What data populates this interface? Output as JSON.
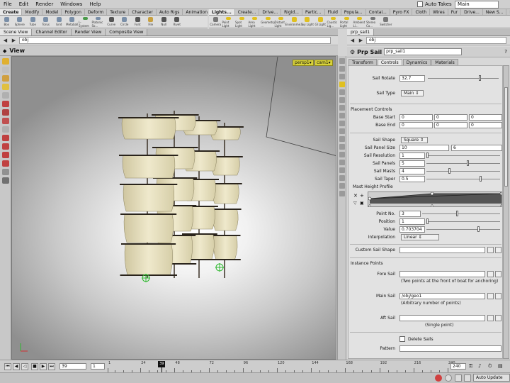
{
  "menubar": {
    "items": [
      "File",
      "Edit",
      "Render",
      "Windows",
      "Help"
    ]
  },
  "auto_takes": {
    "label": "Auto Takes"
  },
  "desktop": {
    "value": "Main"
  },
  "shelf_tabs_left": [
    {
      "label": "Create",
      "active": true
    },
    {
      "label": "Modify",
      "active": false
    },
    {
      "label": "Model",
      "active": false
    },
    {
      "label": "Polygon",
      "active": false
    },
    {
      "label": "Deform",
      "active": false
    },
    {
      "label": "Texture",
      "active": false
    },
    {
      "label": "Character",
      "active": false
    },
    {
      "label": "Auto Rigs",
      "active": false
    },
    {
      "label": "Animation",
      "active": false
    }
  ],
  "shelf_tabs_right": [
    {
      "label": "Lights...",
      "active": true
    },
    {
      "label": "Create...",
      "active": false
    },
    {
      "label": "Drive...",
      "active": false
    },
    {
      "label": "Rigid...",
      "active": false
    },
    {
      "label": "Partic...",
      "active": false
    },
    {
      "label": "Fluid",
      "active": false
    },
    {
      "label": "Popula...",
      "active": false
    },
    {
      "label": "Contai...",
      "active": false
    },
    {
      "label": "Pyro FX",
      "active": false
    },
    {
      "label": "Cloth",
      "active": false
    },
    {
      "label": "Wires",
      "active": false
    },
    {
      "label": "Fur",
      "active": false
    },
    {
      "label": "Drive...",
      "active": false
    },
    {
      "label": "New S...",
      "active": false
    },
    {
      "label": "New S...",
      "active": false
    }
  ],
  "create_tools": [
    {
      "label": "Box",
      "color": "#7a8fa8"
    },
    {
      "label": "Sphere",
      "color": "#7a8fa8"
    },
    {
      "label": "Tube",
      "color": "#7a8fa8"
    },
    {
      "label": "Torus",
      "color": "#7a8fa8"
    },
    {
      "label": "Grid",
      "color": "#7a8fa8"
    },
    {
      "label": "Metaball",
      "color": "#7a8fa8"
    },
    {
      "label": "L-System",
      "color": "#4a9a4a"
    },
    {
      "label": "Platonic So...",
      "color": "#7a8fa8"
    },
    {
      "label": "Curve",
      "color": "#555555"
    },
    {
      "label": "Circle",
      "color": "#7a8fa8"
    },
    {
      "label": "Font",
      "color": "#555555"
    },
    {
      "label": "File",
      "color": "#c8a040"
    },
    {
      "label": "Null",
      "color": "#555555"
    },
    {
      "label": "Rivet",
      "color": "#555555"
    }
  ],
  "light_tools": [
    {
      "label": "Camera",
      "color": "#777777"
    },
    {
      "label": "Point Light",
      "color": "#e0c020"
    },
    {
      "label": "Spot Light",
      "color": "#e0c020"
    },
    {
      "label": "Area Light",
      "color": "#e0c020"
    },
    {
      "label": "Geometry ...",
      "color": "#e0c020"
    },
    {
      "label": "Distant Light",
      "color": "#e0c020"
    },
    {
      "label": "Environme...",
      "color": "#e0c020"
    },
    {
      "label": "Sky Light",
      "color": "#e0c020"
    },
    {
      "label": "GI Light",
      "color": "#e0c020"
    },
    {
      "label": "Caustic Lig...",
      "color": "#e0c020"
    },
    {
      "label": "Portal Light",
      "color": "#e0c020"
    },
    {
      "label": "Ambient Li...",
      "color": "#e0c020"
    },
    {
      "label": "Stereo Ca...",
      "color": "#777777"
    },
    {
      "label": "Switcher",
      "color": "#777777"
    }
  ],
  "pane_tabs": [
    {
      "label": "Scene View",
      "active": true
    },
    {
      "label": "Channel Editor",
      "active": false
    },
    {
      "label": "Render View",
      "active": false
    },
    {
      "label": "Composite View",
      "active": false
    }
  ],
  "scene_path": "obj",
  "view_title": "View",
  "viewport": {
    "persp": "persp1▾",
    "cam": "cam1▾"
  },
  "props_tab": "prp_sail1",
  "props_path": "obj",
  "node": {
    "type": "Prp Sail",
    "name": "prp_sail1"
  },
  "parm_tabs": [
    {
      "label": "Transform",
      "active": false
    },
    {
      "label": "Controls",
      "active": true
    },
    {
      "label": "Dynamics",
      "active": false
    },
    {
      "label": "Materials",
      "active": false
    }
  ],
  "parms": {
    "sail_rotate": {
      "label": "Sail Rotate",
      "value": "32.7",
      "fraction": 0.62
    },
    "sail_type": {
      "label": "Sail Type",
      "value": "Main"
    },
    "placement_controls": "Placement Controls",
    "base_start": {
      "label": "Base Start",
      "values": [
        "0",
        "0",
        "0"
      ]
    },
    "base_end": {
      "label": "Base End",
      "values": [
        "0",
        "0",
        "0"
      ]
    },
    "sail_shape": {
      "label": "Sail Shape",
      "value": "Square"
    },
    "sail_panel_size": {
      "label": "Sail Panel Size",
      "values": [
        "10",
        "6"
      ]
    },
    "sail_resolution": {
      "label": "Sail Resolution",
      "value": "1",
      "fraction": 0.0
    },
    "sail_panels": {
      "label": "Sail Panels",
      "value": "5",
      "fraction": 0.55
    },
    "sail_masts": {
      "label": "Sail Masts",
      "value": "4",
      "fraction": 0.3
    },
    "sail_taper": {
      "label": "Sail Taper",
      "value": "0.5",
      "fraction": 0.72
    },
    "mast_height_profile": "Mast Height Profile",
    "point_no": {
      "label": "Point No.",
      "value": "3",
      "fraction": 0.45
    },
    "position": {
      "label": "Position",
      "value": "1",
      "fraction": 0.0
    },
    "value": {
      "label": "Value",
      "value": "0.703704",
      "fraction": 0.7
    },
    "interpolation": {
      "label": "Interpolation",
      "value": "Linear"
    },
    "custom_sail_shape": {
      "label": "Custom Sail Shape",
      "value": ""
    },
    "instance_points": "Instance Points",
    "fore_sail": {
      "label": "Fore Sail",
      "value": "",
      "note": "(Two points at the front of boat for anchoring)"
    },
    "main_sail": {
      "label": "Main Sail",
      "value": "/obj/geo1",
      "note": "(Arbitrary number of points)"
    },
    "aft_sail": {
      "label": "Aft Sail",
      "value": "",
      "note": "(Single point)"
    },
    "delete_sails": {
      "label": "Delete Sails"
    },
    "pattern": {
      "label": "Pattern",
      "value": ""
    }
  },
  "timeline": {
    "current_frame": "39",
    "step": "1",
    "start": 1,
    "end": 240,
    "end_label": "240",
    "tick_labels": [
      "1",
      "24",
      "48",
      "72",
      "96",
      "120",
      "144",
      "168",
      "192",
      "216",
      "240"
    ],
    "marker_label": "39"
  },
  "status": {
    "auto_update": "Auto Update"
  }
}
